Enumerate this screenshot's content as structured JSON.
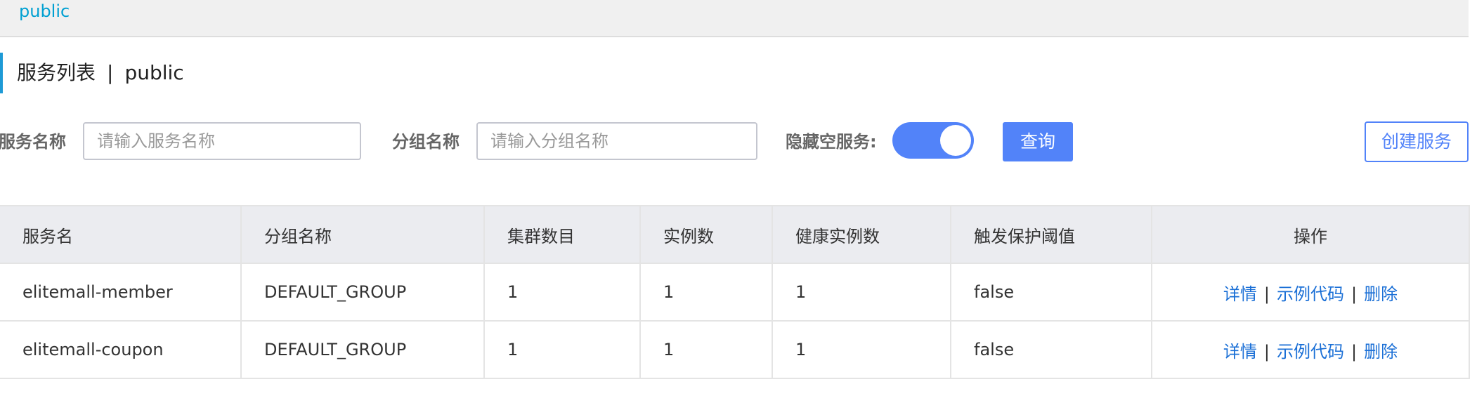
{
  "namespace_bar": {
    "current": "public"
  },
  "page_title": {
    "label": "服务列表",
    "separator": "|",
    "namespace": "public"
  },
  "filters": {
    "service_name_label": "服务名称",
    "service_name_placeholder": "请输入服务名称",
    "service_name_value": "",
    "group_name_label": "分组名称",
    "group_name_placeholder": "请输入分组名称",
    "group_name_value": "",
    "hide_empty_label": "隐藏空服务:",
    "hide_empty_enabled": true,
    "query_button": "查询",
    "create_button": "创建服务"
  },
  "colors": {
    "accent": "#5283f9",
    "link": "#1a6fd6",
    "namespace_link": "#00a0d2",
    "title_bar": "#1e9ad6",
    "header_bg": "#ebecf0"
  },
  "table": {
    "columns": [
      "服务名",
      "分组名称",
      "集群数目",
      "实例数",
      "健康实例数",
      "触发保护阈值",
      "操作"
    ],
    "rows": [
      {
        "service": "elitemall-member",
        "group": "DEFAULT_GROUP",
        "clusters": "1",
        "instances": "1",
        "healthy": "1",
        "threshold": "false"
      },
      {
        "service": "elitemall-coupon",
        "group": "DEFAULT_GROUP",
        "clusters": "1",
        "instances": "1",
        "healthy": "1",
        "threshold": "false"
      }
    ],
    "actions": {
      "detail": "详情",
      "sample_code": "示例代码",
      "delete": "删除",
      "separator": "|"
    }
  }
}
